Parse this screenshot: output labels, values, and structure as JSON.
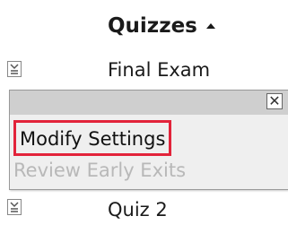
{
  "header": {
    "column_title": "Quizzes",
    "sort_icon": "sort-ascending-icon"
  },
  "rows": [
    {
      "label": "Final Exam",
      "icon": "quiz-dropdown-icon"
    },
    {
      "label": "Quiz 2",
      "icon": "quiz-dropdown-icon"
    }
  ],
  "context_menu": {
    "close_glyph": "✕",
    "items": [
      {
        "label": "Modify Settings",
        "state": "highlighted"
      },
      {
        "label": "Review Early Exits",
        "state": "disabled"
      }
    ]
  },
  "colors": {
    "highlight_border": "#e2233a",
    "disabled_text": "#b8b8b8",
    "titlebar": "#cfcfcf"
  }
}
